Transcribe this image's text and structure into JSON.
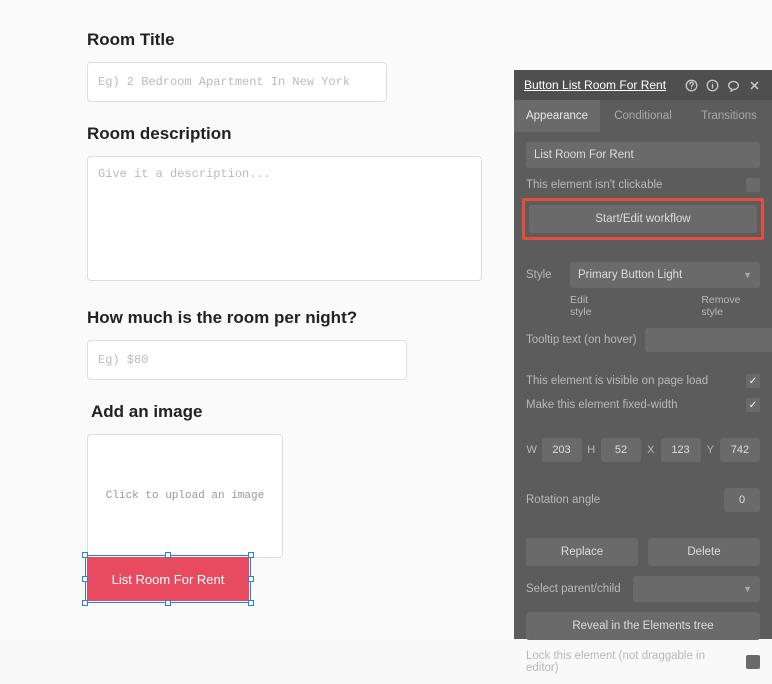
{
  "form": {
    "title_label": "Room Title",
    "title_placeholder": "Eg) 2 Bedroom Apartment In New York",
    "desc_label": "Room description",
    "desc_placeholder": "Give it a description...",
    "price_label": "How much is the room per night?",
    "price_placeholder": "Eg) $80",
    "image_label": "Add an image",
    "upload_text": "Click to upload an image",
    "button_label": "List Room For Rent"
  },
  "inspector": {
    "title": "Button List Room For Rent",
    "tabs": {
      "appearance": "Appearance",
      "conditional": "Conditional",
      "transitions": "Transitions"
    },
    "caption_value": "List Room For Rent",
    "not_clickable": "This element isn't clickable",
    "workflow_btn": "Start/Edit workflow",
    "style_label": "Style",
    "style_value": "Primary Button Light",
    "edit_style": "Edit style",
    "remove_style": "Remove style",
    "tooltip_label": "Tooltip text (on hover)",
    "visible_label": "This element is visible on page load",
    "fixed_label": "Make this element fixed-width",
    "dims": {
      "w_label": "W",
      "w": "203",
      "h_label": "H",
      "h": "52",
      "x_label": "X",
      "x": "123",
      "y_label": "Y",
      "y": "742"
    },
    "rotation_label": "Rotation angle",
    "rotation_value": "0",
    "replace": "Replace",
    "delete": "Delete",
    "select_parent": "Select parent/child",
    "reveal": "Reveal in the Elements tree",
    "lock": "Lock this element (not draggable in editor)"
  }
}
